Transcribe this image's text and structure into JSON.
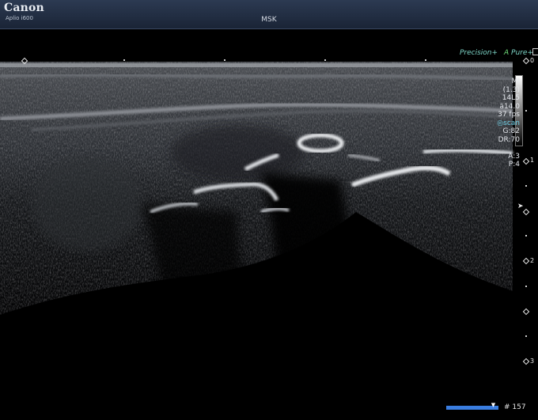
{
  "header": {
    "brand": "Canon",
    "model": "Aplio i600",
    "preset": "MSK"
  },
  "labels": {
    "precision": "Precision+",
    "pure_a": "A",
    "pure": "Pure+"
  },
  "info_lines": [
    {
      "text": "MI",
      "hl": false
    },
    {
      "text": "(1.3)",
      "hl": false
    },
    {
      "text": "14L5",
      "hl": false
    },
    {
      "text": "ä14.0",
      "hl": false
    },
    {
      "text": "37 fps",
      "hl": false
    },
    {
      "text": "◎scan",
      "hl": true
    },
    {
      "text": "G:82",
      "hl": false
    },
    {
      "text": "DR:70",
      "hl": false
    },
    {
      "text": "",
      "hl": false
    },
    {
      "text": "A:3",
      "hl": false
    },
    {
      "text": "P:4",
      "hl": false
    }
  ],
  "depth_scale": [
    "0",
    "1",
    "2",
    "3"
  ],
  "frame": "# 157",
  "cine_position": 0.92
}
